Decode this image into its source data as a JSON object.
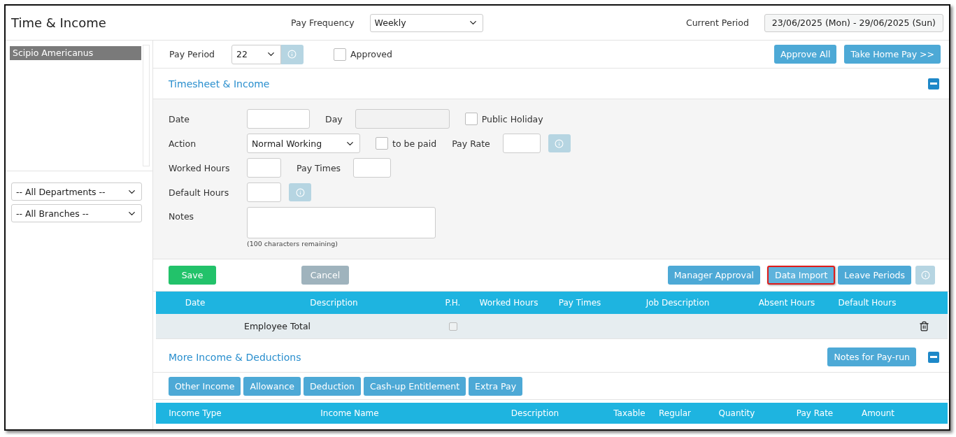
{
  "header": {
    "title": "Time & Income",
    "pay_frequency": {
      "label": "Pay Frequency",
      "value": "Weekly"
    },
    "current_period": {
      "label": "Current Period",
      "value": "23/06/2025 (Mon) - 29/06/2025 (Sun)"
    }
  },
  "sidebar": {
    "employees": [
      {
        "name": "Scipio Americanus",
        "selected": true
      }
    ],
    "filters": [
      {
        "value": "-- All Departments --"
      },
      {
        "value": "-- All Branches --"
      }
    ]
  },
  "pay_bar": {
    "label": "Pay Period",
    "value": "22",
    "approved": {
      "label": "Approved",
      "checked": false
    },
    "buttons": [
      "Approve All",
      "Take Home Pay >>"
    ]
  },
  "timesheet": {
    "title": "Timesheet & Income",
    "expanded": true,
    "rows": [
      [
        {
          "kind": "label",
          "text": "Date"
        },
        {
          "kind": "input",
          "disabled": false
        },
        {
          "kind": "label",
          "text": "Day"
        },
        {
          "kind": "input",
          "disabled": true
        },
        {
          "kind": "checkbox",
          "text": "Public Holiday",
          "checked": false
        }
      ],
      [
        {
          "kind": "label",
          "text": "Action"
        },
        {
          "kind": "select",
          "value": "Normal Working"
        },
        {
          "kind": "checkbox",
          "text": "to be paid",
          "checked": false
        },
        {
          "kind": "label",
          "text": "Pay Rate"
        },
        {
          "kind": "input",
          "disabled": false
        },
        {
          "kind": "info"
        }
      ],
      [
        {
          "kind": "label",
          "text": "Worked Hours"
        },
        {
          "kind": "input",
          "disabled": false
        },
        {
          "kind": "label",
          "text": "Pay Times"
        },
        {
          "kind": "input",
          "disabled": false
        }
      ],
      [
        {
          "kind": "label",
          "text": "Default Hours"
        },
        {
          "kind": "input",
          "disabled": false
        },
        {
          "kind": "info"
        }
      ]
    ],
    "notes": {
      "label": "Notes",
      "hint": "(100 characters remaining)"
    },
    "save": "Save",
    "cancel": "Cancel",
    "actions": [
      {
        "label": "Manager Approval",
        "highlighted": false
      },
      {
        "label": "Data Import",
        "highlighted": true
      },
      {
        "label": "Leave Periods",
        "highlighted": false
      }
    ],
    "table": {
      "columns": [
        "Date",
        "Description",
        "P.H.",
        "Worked Hours",
        "Pay Times",
        "Job Description",
        "Absent Hours",
        "Default Hours"
      ],
      "total": {
        "label": "Employee Total",
        "ph_checked": false
      }
    }
  },
  "more": {
    "title": "More Income & Deductions",
    "expanded": true,
    "notes_button": "Notes for Pay-run",
    "tabs": [
      "Other Income",
      "Allowance",
      "Deduction",
      "Cash-up Entitlement",
      "Extra Pay"
    ],
    "columns": [
      "Income Type",
      "Income Name",
      "Description",
      "Taxable",
      "Regular",
      "Quantity",
      "Pay Rate",
      "Amount"
    ]
  }
}
